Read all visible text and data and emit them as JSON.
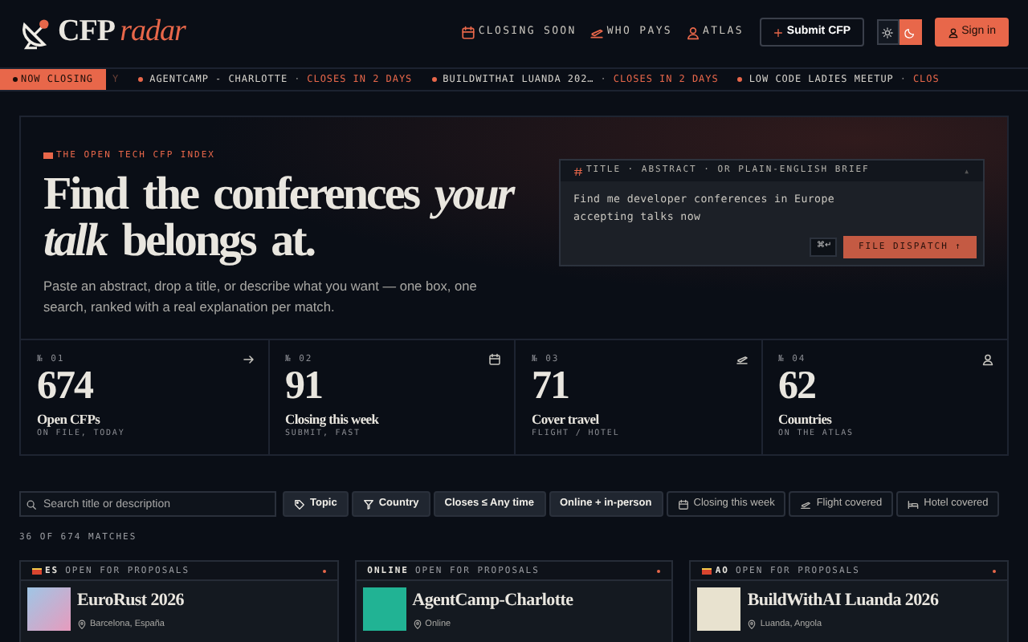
{
  "brand": {
    "name": "CFP",
    "accent": "radar"
  },
  "nav": [
    {
      "label": "CLOSING SOON",
      "kind": "calendar"
    },
    {
      "label": "WHO PAYS",
      "kind": "plane"
    },
    {
      "label": "ATLAS",
      "kind": "person"
    }
  ],
  "submit_button": "Submit CFP",
  "theme_toggle": [
    {
      "kind": "sun",
      "selected": false
    },
    {
      "kind": "moon",
      "selected": true
    }
  ],
  "sign_in_button": "Sign in",
  "ticker": {
    "label": "NOW CLOSING",
    "leading_fragment": "Y",
    "items": [
      {
        "name": "AGENTCAMP - CHARLOTTE",
        "separator": "·",
        "closes": "CLOSES IN 2 DAYS"
      },
      {
        "name": "BUILDWITHAI LUANDA 202…",
        "separator": "·",
        "closes": "CLOSES IN 2 DAYS"
      },
      {
        "name": "LOW CODE LADIES MEETUP",
        "separator": "·",
        "closes": "CLOS"
      }
    ]
  },
  "hero": {
    "eyebrow": "THE OPEN TECH CFP INDEX",
    "heading": "Find the conferences *your talk* belongs at.",
    "lede": "Paste an abstract, drop a title, or describe what you want — one box, one search, ranked with a real explanation per match.",
    "brief": {
      "label": "TITLE · ABSTRACT · OR PLAIN-ENGLISH BRIEF",
      "corner_mark": "▲",
      "value": "Find me developer conferences in Europe accepting talks now",
      "shortcut": "⌘↵",
      "button": "FILE DISPATCH ↑"
    }
  },
  "stats": [
    {
      "index": "№ 01",
      "value": "674",
      "title": "Open CFPs",
      "sub": "ON FILE, TODAY"
    },
    {
      "index": "№ 02",
      "value": "91",
      "title": "Closing this week",
      "sub": "SUBMIT, FAST"
    },
    {
      "index": "№ 03",
      "value": "71",
      "title": "Cover travel",
      "sub": "FLIGHT / HOTEL"
    },
    {
      "index": "№ 04",
      "value": "62",
      "title": "Countries",
      "sub": "ON THE ATLAS"
    }
  ],
  "search": {
    "placeholder": "Search title or description"
  },
  "filters": [
    {
      "label": "Topic",
      "kind": "dropdown"
    },
    {
      "label": "Country",
      "kind": "dropdown"
    },
    {
      "label": "Closes ≤ Any time",
      "kind": "dropdown"
    },
    {
      "label": "Online + in-person",
      "kind": "dropdown"
    },
    {
      "label": "Closing this week",
      "kind": "toggle"
    },
    {
      "label": "Flight covered",
      "kind": "toggle"
    },
    {
      "label": "Hotel covered",
      "kind": "toggle"
    }
  ],
  "match_count": "36 OF 674 MATCHES",
  "cards": [
    {
      "flag": true,
      "code": "ES",
      "status": "OPEN FOR PROPOSALS",
      "title": "EuroRust 2026",
      "location": "Barcelona, España"
    },
    {
      "flag": false,
      "code": "ONLINE",
      "status": "OPEN FOR PROPOSALS",
      "title": "AgentCamp-Charlotte",
      "location": "Online"
    },
    {
      "flag": true,
      "code": "AO",
      "status": "OPEN FOR PROPOSALS",
      "title": "BuildWithAI Luanda 2026",
      "location": "Luanda, Angola"
    }
  ]
}
